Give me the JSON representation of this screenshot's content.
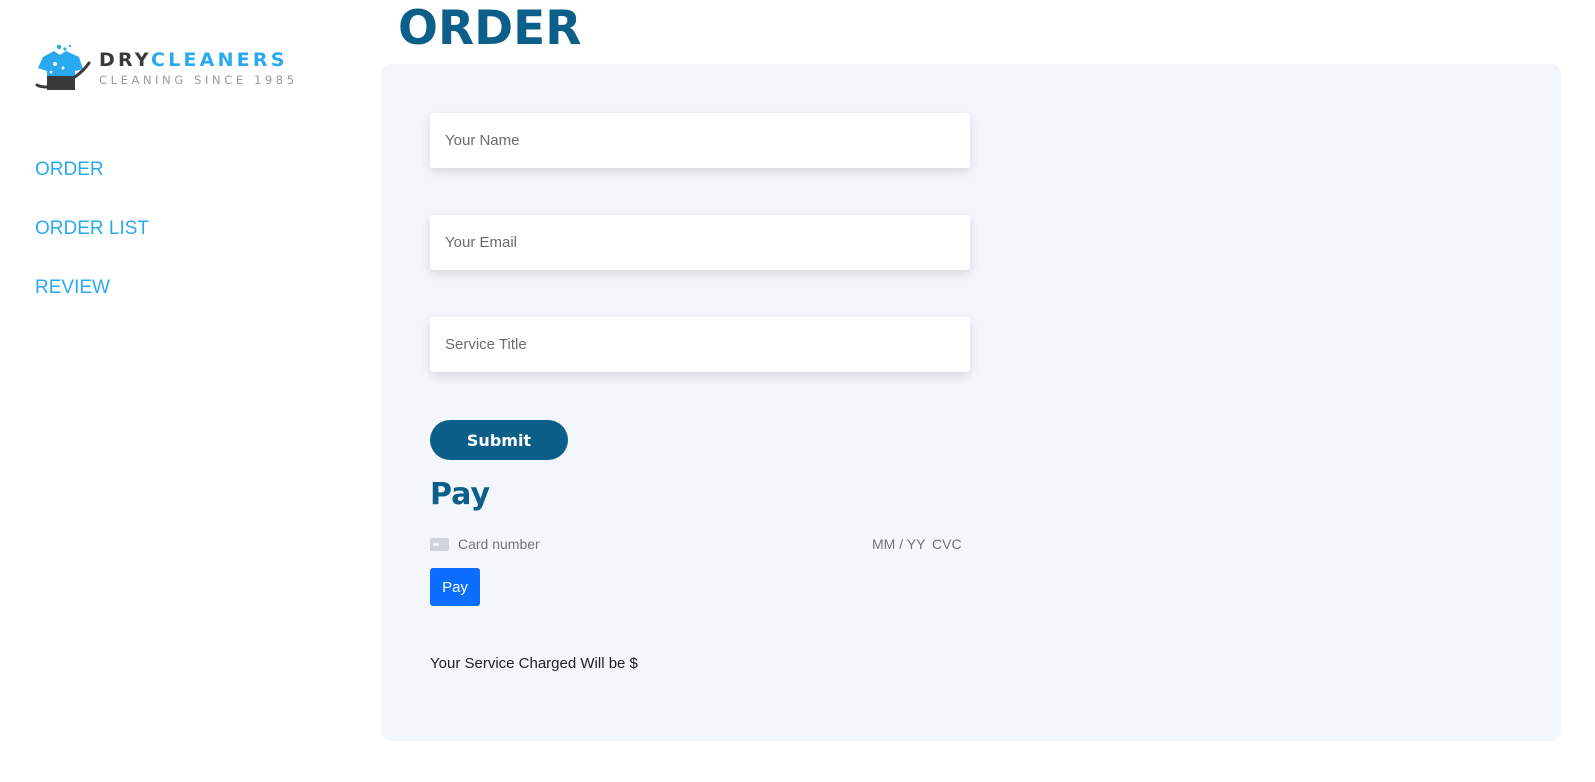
{
  "brand": {
    "word_dark": "DRY",
    "word_accent": "CLEANERS",
    "tagline": "CLEANING SINCE 1985",
    "colors": {
      "dark": "#3a3a3a",
      "accent": "#29aaf0"
    }
  },
  "sidebar": {
    "items": [
      {
        "label": "ORDER"
      },
      {
        "label": "ORDER LIST"
      },
      {
        "label": "REVIEW"
      }
    ]
  },
  "page": {
    "title": "ORDER"
  },
  "form": {
    "name_placeholder": "Your Name",
    "email_placeholder": "Your Email",
    "service_placeholder": "Service Title",
    "submit_label": "Submit"
  },
  "payment": {
    "heading": "Pay",
    "card_number_placeholder": "Card number",
    "expiry_placeholder": "MM / YY",
    "cvc_placeholder": "CVC",
    "pay_label": "Pay",
    "charge_text": "Your Service Charged Will be $"
  },
  "theme": {
    "primary": "#0c5f88",
    "link": "#29aaf0",
    "pay_button": "#0d6efd",
    "panel_bg": "#f3f6fa"
  }
}
